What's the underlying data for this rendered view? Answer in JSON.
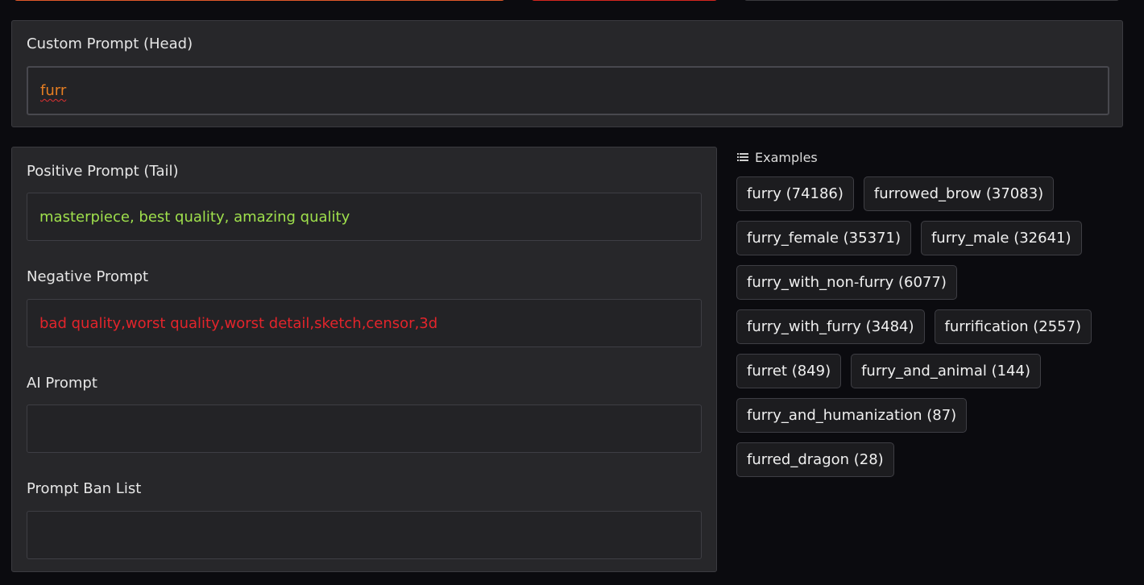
{
  "head": {
    "label": "Custom Prompt (Head)",
    "value": "furr"
  },
  "tail": {
    "label": "Positive Prompt (Tail)",
    "value": "masterpiece, best quality, amazing quality"
  },
  "negative": {
    "label": "Negative Prompt",
    "value": "bad quality,worst quality,worst detail,sketch,censor,3d"
  },
  "ai": {
    "label": "AI Prompt",
    "value": ""
  },
  "ban": {
    "label": "Prompt Ban List",
    "value": ""
  },
  "examples": {
    "title": "Examples",
    "icon": "list-icon",
    "items": [
      "furry (74186)",
      "furrowed_brow (37083)",
      "furry_female (35371)",
      "furry_male (32641)",
      "furry_with_non-furry (6077)",
      "furry_with_furry (3484)",
      "furrification (2557)",
      "furret (849)",
      "furry_and_animal (144)",
      "furry_and_humanization (87)",
      "furred_dragon (28)"
    ]
  },
  "colors": {
    "head_text": "#e67e22",
    "positive_text": "#9fe04c",
    "negative_text": "#e3242b",
    "panel_bg": "#27272a",
    "page_bg": "#0b0b0f"
  }
}
